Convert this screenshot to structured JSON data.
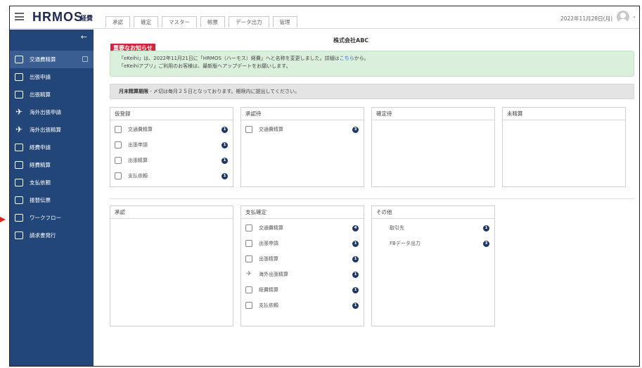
{
  "header": {
    "logo": "HRMOS",
    "logo_sub": "経費",
    "tabs": [
      "承認",
      "確定",
      "マスター",
      "帳票",
      "データ出力",
      "管理"
    ],
    "date": "2022年11月28日(月)"
  },
  "sidebar": {
    "collapse": "←",
    "items": [
      {
        "label": "交通費精算",
        "icon": "train-icon",
        "active": true
      },
      {
        "label": "出張申請",
        "icon": "bus-icon"
      },
      {
        "label": "出張精算",
        "icon": "card-icon"
      },
      {
        "label": "海外出張申請",
        "icon": "plane-icon"
      },
      {
        "label": "海外出張精算",
        "icon": "plane-icon"
      },
      {
        "label": "経費申請",
        "icon": "receipt-icon"
      },
      {
        "label": "経費精算",
        "icon": "receipt-icon"
      },
      {
        "label": "支払依頼",
        "icon": "payment-icon"
      },
      {
        "label": "振替伝票",
        "icon": "transfer-icon"
      },
      {
        "label": "ワークフロー",
        "icon": "document-icon"
      },
      {
        "label": "請求書発行",
        "icon": "invoice-icon"
      }
    ]
  },
  "main": {
    "company": "株式会社ABC",
    "notice_title": "重要なお知らせ",
    "notice_line1_a": "「eKeihi」は、2022年11月21日に「HRMOS（ハーモス）経費」へと名称を変更しました。詳細は",
    "notice_link": "こちら",
    "notice_line1_b": "から。",
    "notice_line2": "「eKeihiアプリ」ご利用のお客様は、最新版へアップデートをお願いします。",
    "deadline_label": "月末精算期限",
    "deadline_text": " - 〆切は毎月２５日となっております。期限内に提出してください。",
    "panels": {
      "draft": {
        "title": "仮登録",
        "rows": [
          {
            "label": "交通費精算",
            "count": "1"
          },
          {
            "label": "出張申請",
            "count": "1"
          },
          {
            "label": "出張精算",
            "count": "1"
          },
          {
            "label": "支払依頼",
            "count": "1"
          }
        ]
      },
      "pending": {
        "title": "承認待",
        "rows": [
          {
            "label": "交通費精算",
            "count": "3"
          }
        ]
      },
      "confirm_wait": {
        "title": "確定待"
      },
      "unsettled": {
        "title": "未精算"
      },
      "approval": {
        "title": "承認"
      },
      "payment": {
        "title": "支払確定",
        "rows": [
          {
            "label": "交通費精算",
            "count": "4"
          },
          {
            "label": "出張申請",
            "count": "1"
          },
          {
            "label": "出張精算",
            "count": "1"
          },
          {
            "label": "海外出張精算",
            "count": "1"
          },
          {
            "label": "経費精算",
            "count": "1"
          },
          {
            "label": "支払依頼",
            "count": "1"
          }
        ]
      },
      "other": {
        "title": "その他",
        "rows": [
          {
            "label": "取引先",
            "count": "1"
          },
          {
            "label": "FBデータ出力",
            "count": "3"
          }
        ]
      }
    }
  }
}
